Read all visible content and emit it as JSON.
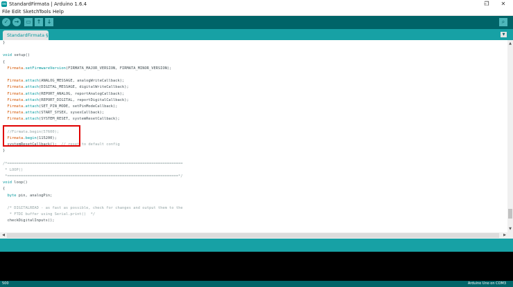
{
  "window": {
    "title": "StandardFirmata | Arduino 1.6.4",
    "icon_label": "oo",
    "minimize": "–",
    "maximize": "❐",
    "close": "✕"
  },
  "menu": [
    "File",
    "Edit",
    "Sketch",
    "Tools",
    "Help"
  ],
  "toolbar": {
    "verify": "✓",
    "upload": "→",
    "new": "▭",
    "open": "↑",
    "save": "↓",
    "serial_monitor": "⌕"
  },
  "tabs": [
    {
      "label": "StandardFirmata §"
    }
  ],
  "tab_menu": "▼",
  "code_lines": [
    [
      {
        "t": "}",
        "c": ""
      }
    ],
    [
      {
        "t": "",
        "c": ""
      }
    ],
    [
      {
        "t": "void",
        "c": "kw"
      },
      {
        "t": " setup()",
        "c": ""
      }
    ],
    [
      {
        "t": "{",
        "c": ""
      }
    ],
    [
      {
        "t": "  ",
        "c": ""
      },
      {
        "t": "Firmata",
        "c": "obj"
      },
      {
        "t": ".",
        "c": ""
      },
      {
        "t": "setFirmwareVersion",
        "c": "kw"
      },
      {
        "t": "(FIRMATA_MAJOR_VERSION, FIRMATA_MINOR_VERSION);",
        "c": ""
      }
    ],
    [
      {
        "t": "",
        "c": ""
      }
    ],
    [
      {
        "t": "  ",
        "c": ""
      },
      {
        "t": "Firmata",
        "c": "obj"
      },
      {
        "t": ".",
        "c": ""
      },
      {
        "t": "attach",
        "c": "kw"
      },
      {
        "t": "(ANALOG_MESSAGE, analogWriteCallback);",
        "c": ""
      }
    ],
    [
      {
        "t": "  ",
        "c": ""
      },
      {
        "t": "Firmata",
        "c": "obj"
      },
      {
        "t": ".",
        "c": ""
      },
      {
        "t": "attach",
        "c": "kw"
      },
      {
        "t": "(DIGITAL_MESSAGE, digitalWriteCallback);",
        "c": ""
      }
    ],
    [
      {
        "t": "  ",
        "c": ""
      },
      {
        "t": "Firmata",
        "c": "obj"
      },
      {
        "t": ".",
        "c": ""
      },
      {
        "t": "attach",
        "c": "kw"
      },
      {
        "t": "(REPORT_ANALOG, reportAnalogCallback);",
        "c": ""
      }
    ],
    [
      {
        "t": "  ",
        "c": ""
      },
      {
        "t": "Firmata",
        "c": "obj"
      },
      {
        "t": ".",
        "c": ""
      },
      {
        "t": "attach",
        "c": "kw"
      },
      {
        "t": "(REPORT_DIGITAL, reportDigitalCallback);",
        "c": ""
      }
    ],
    [
      {
        "t": "  ",
        "c": ""
      },
      {
        "t": "Firmata",
        "c": "obj"
      },
      {
        "t": ".",
        "c": ""
      },
      {
        "t": "attach",
        "c": "kw"
      },
      {
        "t": "(SET_PIN_MODE, setPinModeCallback);",
        "c": ""
      }
    ],
    [
      {
        "t": "  ",
        "c": ""
      },
      {
        "t": "Firmata",
        "c": "obj"
      },
      {
        "t": ".",
        "c": ""
      },
      {
        "t": "attach",
        "c": "kw"
      },
      {
        "t": "(START_SYSEX, sysexCallback);",
        "c": ""
      }
    ],
    [
      {
        "t": "  ",
        "c": ""
      },
      {
        "t": "Firmata",
        "c": "obj"
      },
      {
        "t": ".",
        "c": ""
      },
      {
        "t": "attach",
        "c": "kw"
      },
      {
        "t": "(SYSTEM_RESET, systemResetCallback);",
        "c": ""
      }
    ],
    [
      {
        "t": "",
        "c": ""
      }
    ],
    [
      {
        "t": "  //Firmata.begin(57600);",
        "c": "cm"
      }
    ],
    [
      {
        "t": "  ",
        "c": ""
      },
      {
        "t": "Firmata",
        "c": "obj"
      },
      {
        "t": ".",
        "c": ""
      },
      {
        "t": "begin",
        "c": "kw"
      },
      {
        "t": "(115200);",
        "c": ""
      }
    ],
    [
      {
        "t": "  systemResetCallback();  ",
        "c": ""
      },
      {
        "t": "// reset to default config",
        "c": "cm"
      }
    ],
    [
      {
        "t": "}",
        "c": ""
      }
    ],
    [
      {
        "t": "",
        "c": ""
      }
    ],
    [
      {
        "t": "/*==============================================================================",
        "c": "cm"
      }
    ],
    [
      {
        "t": " * LOOP()",
        "c": "cm"
      }
    ],
    [
      {
        "t": " *============================================================================*/",
        "c": "cm"
      }
    ],
    [
      {
        "t": "void",
        "c": "kw"
      },
      {
        "t": " loop()",
        "c": ""
      }
    ],
    [
      {
        "t": "{",
        "c": ""
      }
    ],
    [
      {
        "t": "  ",
        "c": ""
      },
      {
        "t": "byte",
        "c": "kw"
      },
      {
        "t": " pin, analogPin;",
        "c": ""
      }
    ],
    [
      {
        "t": "",
        "c": ""
      }
    ],
    [
      {
        "t": "  /* DIGITALREAD - as fast as possible, check for changes and output them to the",
        "c": "cm"
      }
    ],
    [
      {
        "t": "   * FTDI buffer using Serial.print()  */",
        "c": "cm"
      }
    ],
    [
      {
        "t": "  checkDigitalInputs();",
        "c": ""
      }
    ]
  ],
  "status": {
    "line": "500",
    "board": "Arduino Uno on COM3"
  },
  "colors": {
    "toolbar": "#006468",
    "tabbar": "#17a1a5",
    "highlight": "#e00000"
  }
}
